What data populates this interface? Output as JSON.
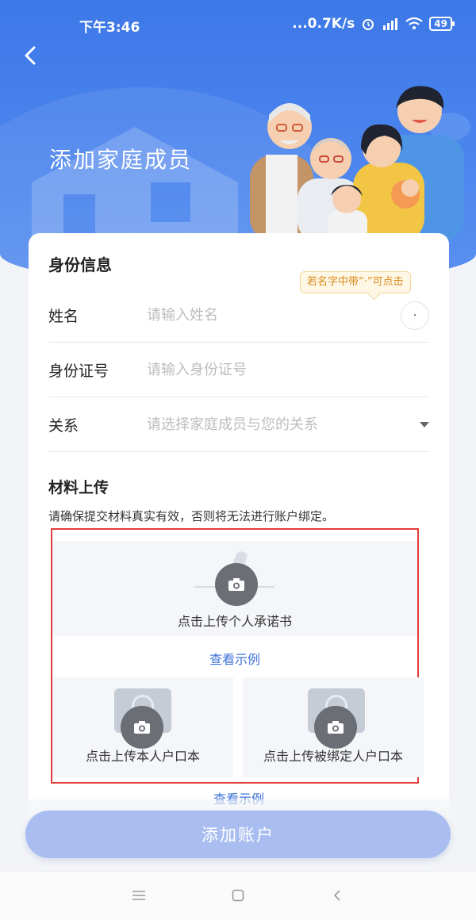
{
  "status_bar": {
    "time": "下午3:46",
    "network_speed": "...0.7K/s",
    "battery": "49"
  },
  "header": {
    "title": "添加家庭成员"
  },
  "identity": {
    "section_title": "身份信息",
    "name_hint": "若名字中带“·”可点击",
    "dot_button": "·",
    "fields": [
      {
        "label": "姓名",
        "placeholder": "请输入姓名"
      },
      {
        "label": "身份证号",
        "placeholder": "请输入身份证号"
      },
      {
        "label": "关系",
        "placeholder": "请选择家庭成员与您的关系"
      }
    ]
  },
  "materials": {
    "section_title": "材料上传",
    "notice": "请确保提交材料真实有效，否则将无法进行账户绑定。",
    "upload_commitment": "点击上传个人承诺书",
    "view_example": "查看示例",
    "upload_own_hukou": "点击上传本人户口本",
    "upload_bound_hukou": "点击上传被绑定人户口本",
    "view_example_2": "查看示例"
  },
  "actions": {
    "add_account": "添加账户"
  },
  "colors": {
    "primary": "#3d78e8",
    "button_disabled": "#a9bdf0",
    "link": "#3f73d8",
    "highlight_frame": "#e23b3b",
    "hint_text": "#d98b1a"
  }
}
